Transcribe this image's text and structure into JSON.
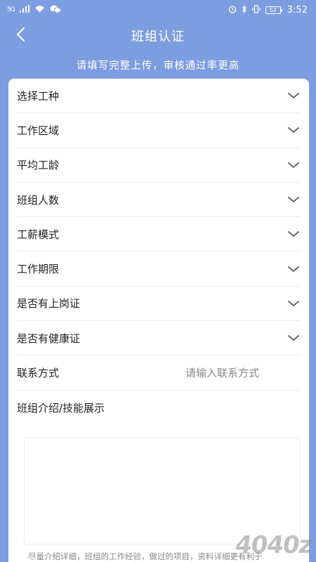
{
  "status_bar": {
    "signal_label": "5G",
    "battery_level": "52",
    "time": "3:52"
  },
  "header": {
    "title": "班组认证",
    "subtitle": "请填写完整上传，审核通过率更高"
  },
  "form": {
    "select_rows": [
      {
        "label": "选择工种"
      },
      {
        "label": "工作区域"
      },
      {
        "label": "平均工龄"
      },
      {
        "label": "班组人数"
      },
      {
        "label": "工薪模式"
      },
      {
        "label": "工作期限"
      },
      {
        "label": "是否有上岗证"
      },
      {
        "label": "是否有健康证"
      }
    ],
    "contact": {
      "label": "联系方式",
      "value": "",
      "placeholder": "请输入联系方式"
    },
    "intro": {
      "label": "班组介绍/技能展示",
      "value": ""
    },
    "hint": "尽量介绍详细，班组的工作经验，做过的项目，资料详细更有利于"
  },
  "watermark": "4040z"
}
